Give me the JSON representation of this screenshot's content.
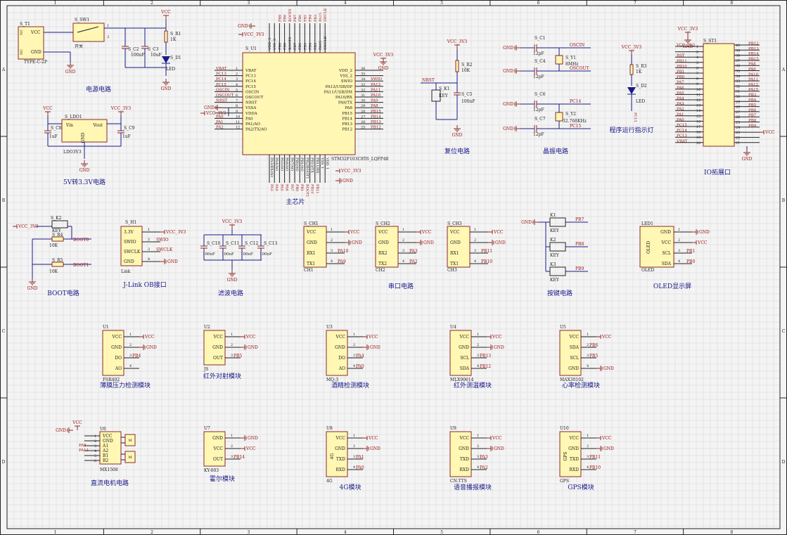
{
  "frame": {
    "columns": [
      "1",
      "2",
      "3",
      "4",
      "5",
      "6",
      "7",
      "8"
    ],
    "rows": [
      "A",
      "B",
      "C",
      "D"
    ]
  },
  "nets": {
    "vcc": "VCC",
    "vcc3v3": "VCC_3V3",
    "gnd": "GND"
  },
  "sections": {
    "power": "电源电路",
    "ldo": "5V转3.3V电路",
    "mcu": "主芯片",
    "reset": "复位电路",
    "crystal": "晶振电路",
    "led": "程序运行指示灯",
    "io": "IO拓展口",
    "boot": "BOOT电路",
    "jlink": "J-Link OB接口",
    "filter": "滤波电路",
    "serial": "串口电路",
    "keys": "按键电路",
    "oled": "OLED显示屏",
    "fsr": "薄膜压力检测模块",
    "ir": "红外对射模块",
    "alcohol": "酒精检测模块",
    "irtemp": "红外测温模块",
    "heart": "心率检测模块",
    "motor": "直流电机电路",
    "hall": "霍尔模块",
    "g4": "4G模块",
    "tts": "语音播报模块",
    "gps": "GPS模块"
  },
  "power": {
    "t1": "S_T1",
    "t1_part": "TYPE-C-2P",
    "t1_nc": "NC",
    "sw1": "S_SW1",
    "sw1_part": "开关",
    "r1": "S_R1",
    "r1_val": "1K",
    "c2": "S_C2",
    "c2_val": "100nF",
    "c3": "S_C3",
    "c3_val": "10uF",
    "d1": "S_D1",
    "d1_part": "LED"
  },
  "ldo": {
    "ref": "S_LDO1",
    "part": "LDO3V3",
    "vin": "Vin",
    "vout": "Vout",
    "c8": "S_C8",
    "c9": "S_C9",
    "cval": "1uF"
  },
  "mcu": {
    "ref": "S_U1",
    "part": "STM32F103C8T6_LQFP48",
    "left_pins": [
      {
        "net": "VBAT",
        "name": "VBAT",
        "num": "1"
      },
      {
        "net": "PC13",
        "name": "PC13",
        "num": "2"
      },
      {
        "net": "PC14",
        "name": "PC14",
        "num": "3"
      },
      {
        "net": "PC15",
        "name": "PC15",
        "num": "4"
      },
      {
        "net": "OSCIN",
        "name": "OSCIN",
        "num": "5"
      },
      {
        "net": "OSCOUT",
        "name": "OSCOUT",
        "num": "6"
      },
      {
        "net": "NRST",
        "name": "NRST",
        "num": "7"
      },
      {
        "net": "",
        "name": "VSSA",
        "num": "8"
      },
      {
        "net": "",
        "name": "VDDA",
        "num": "9"
      },
      {
        "net": "PA0",
        "name": "PA0",
        "num": "10"
      },
      {
        "net": "PA1",
        "name": "PA1/AO",
        "num": "11"
      },
      {
        "net": "PA2",
        "name": "PA2/TX/AO",
        "num": "12"
      }
    ],
    "right_pins": [
      {
        "name": "VDD_2",
        "num": "36",
        "net": ""
      },
      {
        "name": "VSS_2",
        "num": "35",
        "net": ""
      },
      {
        "name": "SWIO",
        "num": "34",
        "net": "SWIO"
      },
      {
        "name": "PA12/USB/DP",
        "num": "33",
        "net": "PA12"
      },
      {
        "name": "PA11/USB/DM",
        "num": "32",
        "net": "PA11"
      },
      {
        "name": "PA10/RX",
        "num": "31",
        "net": "PA10"
      },
      {
        "name": "PA9/TX",
        "num": "30",
        "net": "PA9"
      },
      {
        "name": "PA8",
        "num": "29",
        "net": "PA8"
      },
      {
        "name": "PB15",
        "num": "28",
        "net": "PB15"
      },
      {
        "name": "PB14",
        "num": "27",
        "net": "PB14"
      },
      {
        "name": "PB13",
        "num": "26",
        "net": "PB13"
      },
      {
        "name": "PB12",
        "num": "25",
        "net": "PB12"
      }
    ],
    "top_pins": [
      "VDD_3",
      "VSS_3",
      "PB9",
      "PB8",
      "BOOT0",
      "PB7",
      "PB6",
      "PB5",
      "PB4",
      "PB3",
      "PA15",
      "SWCLK"
    ],
    "top_nets": [
      "PB9",
      "PB8",
      "BOOT0",
      "PB7",
      "PB6",
      "PB5",
      "PB4",
      "PB3",
      "PA15",
      "SWCLK"
    ],
    "bottom_pins": [
      "PA3/RX/AO",
      "PA4/AO",
      "PA5/AO",
      "PA6/AO",
      "PA7/AO",
      "PB0/AO",
      "PB1/AO",
      "PB2/BOOT1",
      "PB10/TX",
      "PB11/RX",
      "VSS_1",
      "VDD_1"
    ],
    "bottom_nets": [
      "PA3",
      "PA4",
      "PA5",
      "PA6",
      "PA7",
      "PB0",
      "PB1",
      "BOOT1",
      "PB10",
      "PB11"
    ]
  },
  "reset": {
    "r2": "S_R2",
    "r2_val": "10K",
    "k1": "S_K1",
    "k1_part": "KEY",
    "c5": "S_C5",
    "c5_val": "100nF",
    "net": "NRST"
  },
  "crystal": {
    "c1": "S_C1",
    "c4": "S_C4",
    "c6": "S_C6",
    "c7": "S_C7",
    "cval": "12pF",
    "y1": "S_Y1",
    "y1_val": "8MHz",
    "y2": "S_Y2",
    "y2_val": "32.768KHz",
    "oscin": "OSCIN",
    "oscout": "OSCOUT",
    "pc14": "PC14",
    "pc15": "PC15"
  },
  "led": {
    "r3": "S_R3",
    "r3_val": "1K",
    "d2": "S_D2",
    "d2_part": "LED",
    "net": "PC13"
  },
  "io": {
    "ref": "S_ST1",
    "left": [
      {
        "net": "VCC_3V3",
        "num": "1"
      },
      {
        "net": "",
        "num": "2"
      },
      {
        "net": "RST",
        "num": "4"
      },
      {
        "net": "PB11",
        "num": "5"
      },
      {
        "net": "PB10",
        "num": "6"
      },
      {
        "net": "PB1",
        "num": "7"
      },
      {
        "net": "PB0",
        "num": "8"
      },
      {
        "net": "PA7",
        "num": "9"
      },
      {
        "net": "PA6",
        "num": "10"
      },
      {
        "net": "PA5",
        "num": "11"
      },
      {
        "net": "PA4",
        "num": "12"
      },
      {
        "net": "PA3",
        "num": "13"
      },
      {
        "net": "PA2",
        "num": "14"
      },
      {
        "net": "PA1",
        "num": "15"
      },
      {
        "net": "PA0",
        "num": "16"
      },
      {
        "net": "PC15",
        "num": "17"
      },
      {
        "net": "PC14",
        "num": "18"
      },
      {
        "net": "PC13",
        "num": "19"
      },
      {
        "net": "VBAT",
        "num": "20"
      }
    ],
    "right": [
      {
        "net": "PB12",
        "num": "40"
      },
      {
        "net": "PB13",
        "num": "39"
      },
      {
        "net": "PB14",
        "num": "38"
      },
      {
        "net": "PB15",
        "num": "37"
      },
      {
        "net": "PA8",
        "num": "36"
      },
      {
        "net": "PA9",
        "num": "35"
      },
      {
        "net": "PA10",
        "num": "34"
      },
      {
        "net": "PA11",
        "num": "33"
      },
      {
        "net": "PA12",
        "num": "32"
      },
      {
        "net": "PA15",
        "num": "31"
      },
      {
        "net": "PB3",
        "num": "30"
      },
      {
        "net": "PB4",
        "num": "29"
      },
      {
        "net": "PB5",
        "num": "28"
      },
      {
        "net": "PB6",
        "num": "27"
      },
      {
        "net": "PB7",
        "num": "26"
      },
      {
        "net": "PB8",
        "num": "25"
      },
      {
        "net": "PB9",
        "num": "24"
      },
      {
        "net": "VCC",
        "num": "23"
      },
      {
        "net": "",
        "num": "22"
      },
      {
        "net": "",
        "num": "21"
      }
    ]
  },
  "boot": {
    "k2": "S_K2",
    "k2_part": "KEY",
    "r4": "S_R4",
    "r5": "S_R5",
    "rval": "10K",
    "boot0": "BOOT0",
    "boot1": "BOOT1"
  },
  "jlink": {
    "ref": "S_H1",
    "part": "Link",
    "pins": [
      {
        "name": "3.3V",
        "net": "VCC_3V3",
        "num": "1"
      },
      {
        "name": "SWIO",
        "net": "SWIO",
        "num": "2"
      },
      {
        "name": "SWCLK",
        "net": "SWCLK",
        "num": "3"
      },
      {
        "name": "GND",
        "net": "",
        "num": "4"
      }
    ]
  },
  "filter": {
    "caps": [
      {
        "ref": "S_C10",
        "val": "100nF"
      },
      {
        "ref": "S_C11",
        "val": "100nF"
      },
      {
        "ref": "S_C12",
        "val": "100nF"
      },
      {
        "ref": "S_C13",
        "val": "100nF"
      }
    ]
  },
  "serial": [
    {
      "ref": "S_CH1",
      "part": "CH1",
      "rx": "PA10",
      "tx": "PA9"
    },
    {
      "ref": "S_CH2",
      "part": "CH2",
      "rx": "PA3",
      "tx": "PA2"
    },
    {
      "ref": "S_CH3",
      "part": "CH3",
      "rx": "PB11",
      "tx": "PB10"
    }
  ],
  "serial_pins": [
    "VCC",
    "GND",
    "RX1",
    "TX1"
  ],
  "serial_pins_ch2": [
    "VCC",
    "GND",
    "RX2",
    "TX2"
  ],
  "serial_pins_ch3": [
    "VCC",
    "GND",
    "RX1",
    "TX1"
  ],
  "keys": {
    "refs": [
      "K1",
      "K2",
      "K3"
    ],
    "part": "KEY",
    "nets": [
      "PB7",
      "PB8",
      "PB9"
    ]
  },
  "oled": {
    "ref": "LED1",
    "part": "OLED",
    "label": "OLED",
    "pins": [
      "GND",
      "VCC",
      "SCL",
      "SDA"
    ],
    "nets": [
      "",
      "",
      "PB1",
      "PB0"
    ]
  },
  "modules": [
    {
      "key": "fsr",
      "ref": "U1",
      "part": "FSR402",
      "pins": [
        "VCC",
        "GND",
        "DO",
        "AO"
      ],
      "nets": [
        "VCC",
        "",
        "PB4",
        ""
      ]
    },
    {
      "key": "ir",
      "ref": "U2",
      "part": "JS",
      "pins": [
        "VCC",
        "GND",
        "OUT"
      ],
      "nets": [
        "VCC",
        "",
        "PB5"
      ]
    },
    {
      "key": "alcohol",
      "ref": "U3",
      "part": "MQ-3",
      "pins": [
        "VCC",
        "GND",
        "DO",
        "AO"
      ],
      "nets": [
        "VCC",
        "",
        "PA4",
        "PA0"
      ]
    },
    {
      "key": "irtemp",
      "ref": "U4",
      "part": "MLX90614",
      "pins": [
        "VCC",
        "GND",
        "SCL",
        "SDA"
      ],
      "nets": [
        "VCC",
        "",
        "PB13",
        "PB12"
      ]
    },
    {
      "key": "heart",
      "ref": "U5",
      "part": "MAX30102",
      "pins": [
        "VCC",
        "SDA",
        "SCL",
        "GND"
      ],
      "nets": [
        "VCC",
        "PB6",
        "PB5",
        ""
      ]
    },
    {
      "key": "hall",
      "ref": "U7",
      "part": "KY-003",
      "pins": [
        "GND",
        "VCC",
        "OUT"
      ],
      "nets": [
        "",
        "VCC",
        "PB14"
      ]
    },
    {
      "key": "g4",
      "ref": "U8",
      "part": "4G",
      "label": "4G",
      "pins": [
        "VCC",
        "GND",
        "TXD",
        "RXD"
      ],
      "nets": [
        "VCC",
        "",
        "PA1",
        "PA0"
      ]
    },
    {
      "key": "tts",
      "ref": "U9",
      "part": "CN-TTS",
      "pins": [
        "VCC",
        "GND",
        "TXD",
        "RXD"
      ],
      "nets": [
        "VCC",
        "",
        "PA3",
        "PA2"
      ]
    },
    {
      "key": "gps",
      "ref": "U10",
      "part": "GPS",
      "label": "GPS",
      "pins": [
        "VCC",
        "GND",
        "TXD",
        "RXD"
      ],
      "nets": [
        "VCC",
        "",
        "PB11",
        "PB10"
      ]
    }
  ],
  "motor": {
    "ref": "U6",
    "part": "MX1508",
    "pins": [
      "VCC",
      "GND",
      "A1",
      "A2",
      "B1",
      "B2"
    ],
    "nets": [
      "PA8",
      "PA11"
    ],
    "m_label": "M"
  }
}
